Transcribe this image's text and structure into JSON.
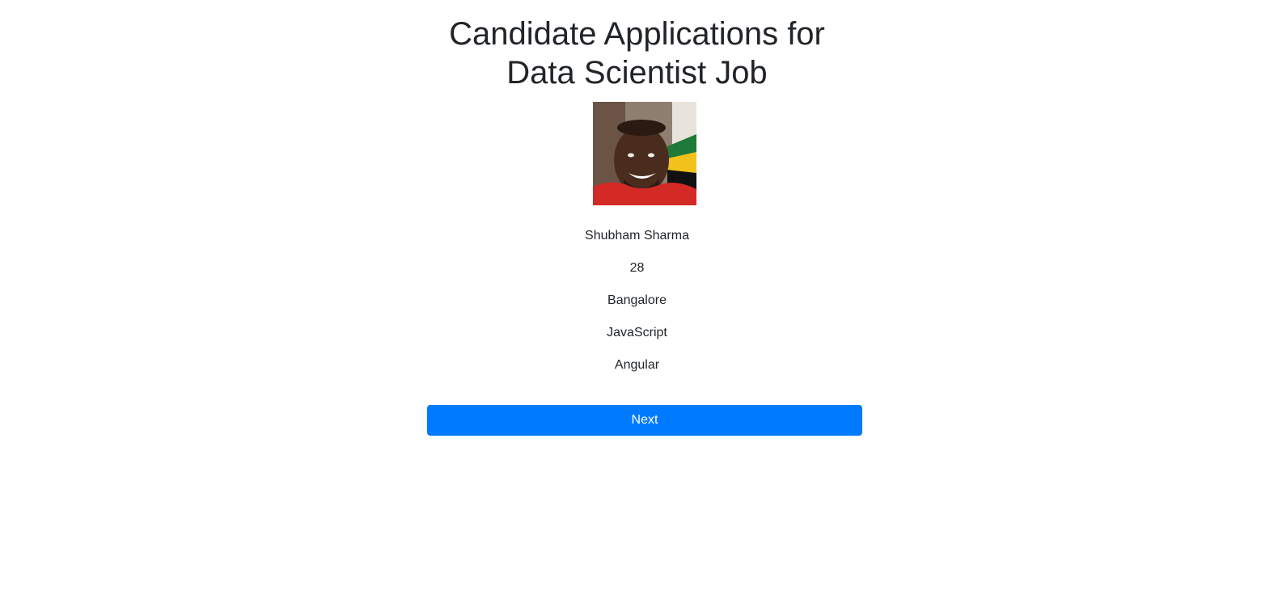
{
  "page": {
    "title_line1": "Candidate Applications for",
    "title_line2": "Data Scientist Job"
  },
  "candidate": {
    "photo_icon": "candidate-photo",
    "name": "Shubham Sharma",
    "age": "28",
    "location": "Bangalore",
    "skill_1": "JavaScript",
    "skill_2": "Angular"
  },
  "actions": {
    "next_label": "Next"
  },
  "colors": {
    "primary": "#007bff",
    "text": "#212529",
    "background": "#ffffff"
  }
}
